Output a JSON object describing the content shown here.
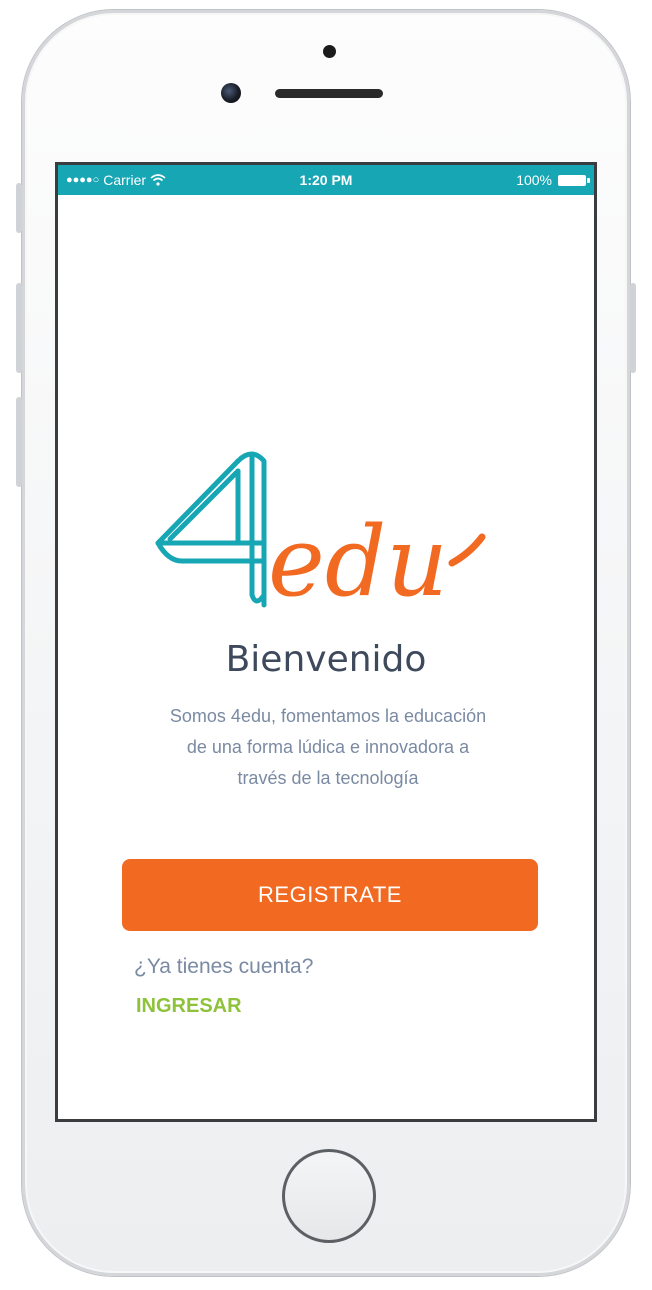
{
  "status_bar": {
    "carrier": "Carrier",
    "time": "1:20 PM",
    "battery": "100%"
  },
  "logo": {
    "brand_number": "4",
    "brand_text": "edu",
    "colors": {
      "teal": "#17a6b4",
      "orange": "#f26a21"
    }
  },
  "welcome": {
    "title": "Bienvenido",
    "line1": "Somos 4edu, fomentamos la educación",
    "line2": "de una forma lúdica e innovadora a",
    "line3": "través de la tecnología"
  },
  "actions": {
    "register_label": "REGISTRATE",
    "account_question": "¿Ya tienes cuenta?",
    "login_label": "INGRESAR"
  },
  "theme": {
    "statusbar": "#17a6b4",
    "primary": "#f26a21",
    "link": "#8fc23b",
    "text_muted": "#7a8aa3"
  }
}
